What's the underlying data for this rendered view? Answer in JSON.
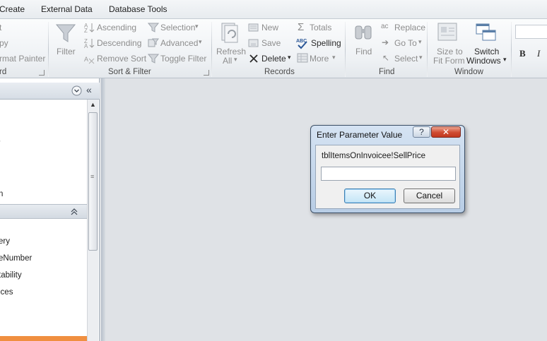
{
  "tabs": [
    "Create",
    "External Data",
    "Database Tools"
  ],
  "ribbon": {
    "clipboard": {
      "items": [
        "t",
        "py",
        "rmat Painter"
      ],
      "label": "rd"
    },
    "sort_filter": {
      "label": "Sort & Filter",
      "filter": "Filter",
      "ascending": "Ascending",
      "descending": "Descending",
      "remove_sort": "Remove Sort",
      "selection": "Selection",
      "advanced": "Advanced",
      "toggle_filter": "Toggle Filter"
    },
    "records": {
      "label": "Records",
      "refresh_line1": "Refresh",
      "refresh_line2": "All",
      "new": "New",
      "save": "Save",
      "delete": "Delete",
      "totals": "Totals",
      "spelling": "Spelling",
      "more": "More"
    },
    "find": {
      "label": "Find",
      "find": "Find",
      "replace": "Replace",
      "goto": "Go To",
      "select": "Select"
    },
    "window": {
      "label": "Window",
      "size_to_fit_line1": "Size to",
      "size_to_fit_line2": "Fit Form",
      "switch_line1": "Switch",
      "switch_line2": "Windows"
    },
    "text_format": {
      "bold": "B",
      "italic": "I"
    }
  },
  "nav": {
    "top_items": [
      "t",
      "n"
    ],
    "group_items": [
      "ery",
      "eNumber",
      "tability",
      "ices"
    ]
  },
  "dialog": {
    "title": "Enter Parameter Value",
    "help": "?",
    "close": "✕",
    "prompt": "tblItemsOnInvoicee!SellPrice",
    "input_value": "",
    "ok": "OK",
    "cancel": "Cancel"
  }
}
